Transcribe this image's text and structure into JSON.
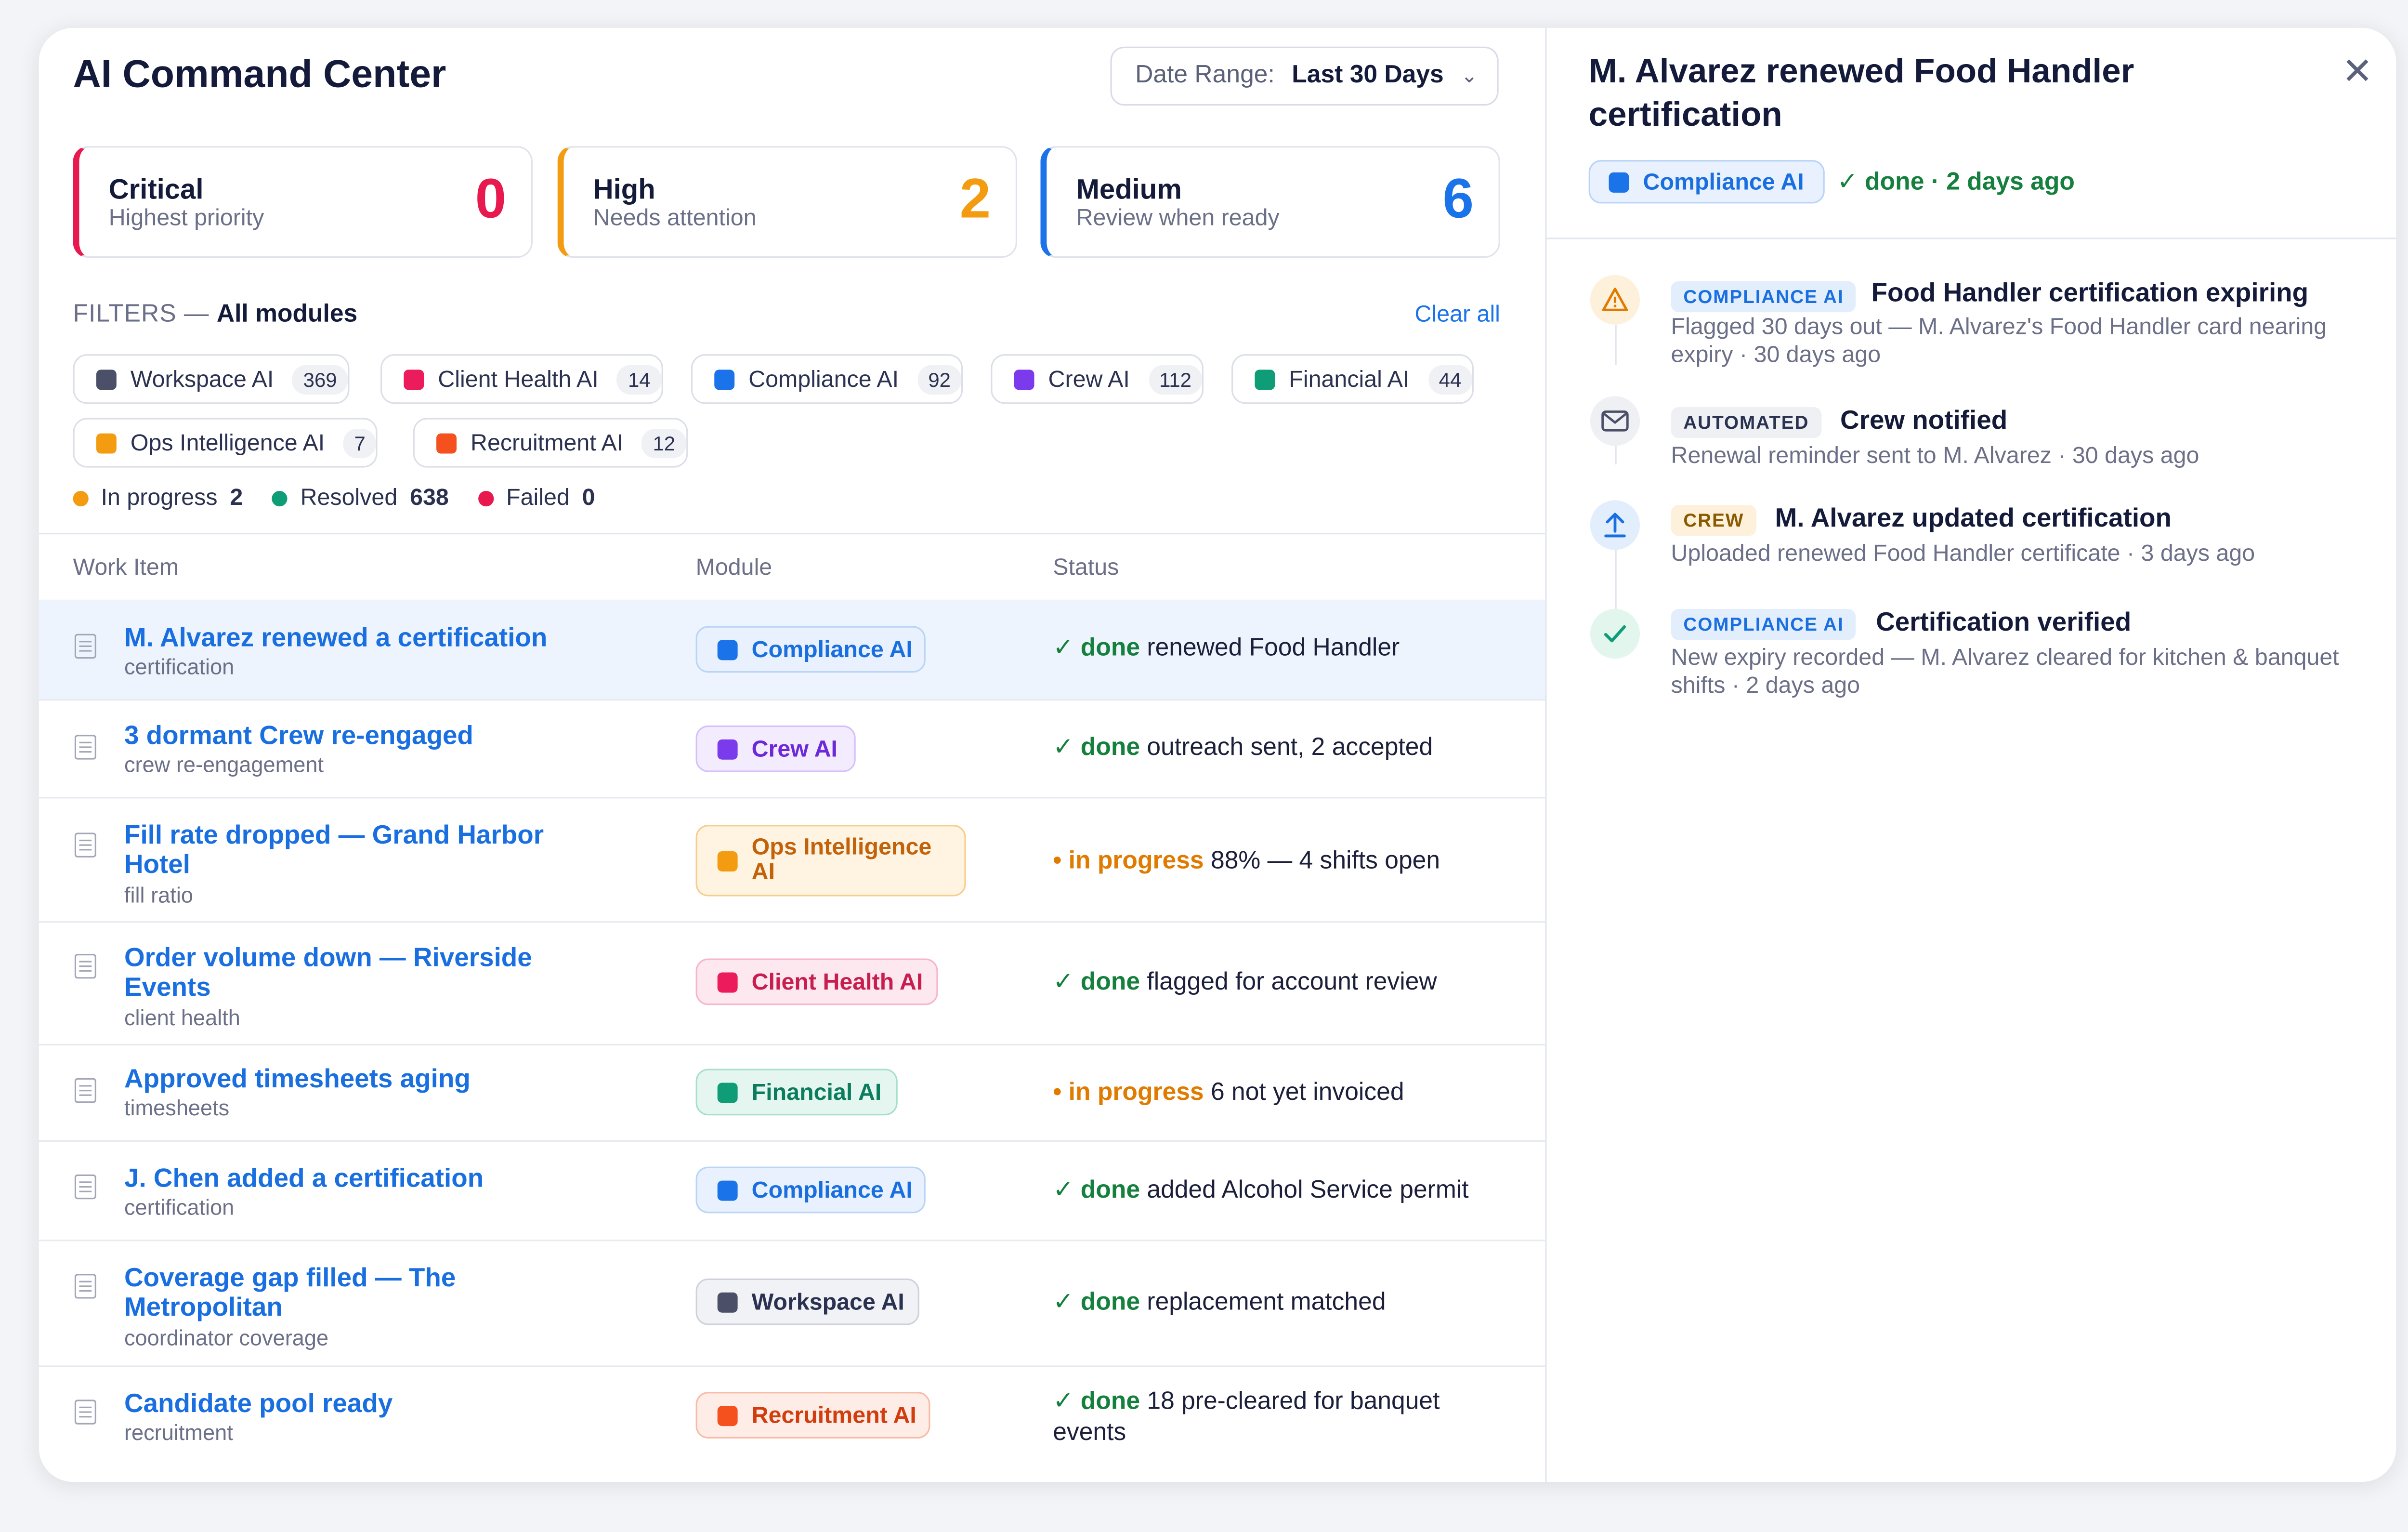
{
  "app_title": "AI Command Center",
  "date_range": {
    "label": "Date Range:",
    "value": "Last 30 Days"
  },
  "priority": [
    {
      "title": "Critical",
      "subtitle": "Highest priority",
      "count": "0",
      "color": "#e8194f"
    },
    {
      "title": "High",
      "subtitle": "Needs attention",
      "count": "2",
      "color": "#f39c12"
    },
    {
      "title": "Medium",
      "subtitle": "Review when ready",
      "count": "6",
      "color": "#1a73e8"
    }
  ],
  "filters": {
    "label": "FILTERS —",
    "scope": "All modules",
    "clear_all": "Clear all",
    "modules": [
      {
        "name": "Workspace AI",
        "count": "369",
        "color": "#4b5068"
      },
      {
        "name": "Client Health AI",
        "count": "14",
        "color": "#ec1b5b"
      },
      {
        "name": "Compliance AI",
        "count": "92",
        "color": "#1a73e8"
      },
      {
        "name": "Crew AI",
        "count": "112",
        "color": "#7c3aed"
      },
      {
        "name": "Financial AI",
        "count": "44",
        "color": "#0f9d77"
      },
      {
        "name": "Ops Intelligence AI",
        "count": "7",
        "color": "#f39c12"
      },
      {
        "name": "Recruitment AI",
        "count": "12",
        "color": "#f4511e"
      }
    ],
    "legend": [
      {
        "label": "In progress",
        "count": "2",
        "color": "#f39c12"
      },
      {
        "label": "Resolved",
        "count": "638",
        "color": "#0f9d77"
      },
      {
        "label": "Failed",
        "count": "0",
        "color": "#e8194f"
      }
    ]
  },
  "table": {
    "columns": [
      "Work Item",
      "Module",
      "Status"
    ],
    "rows": [
      {
        "title": "M. Alvarez renewed a certification",
        "sub": "certification",
        "module": "Compliance AI",
        "state": "done",
        "detail": "renewed Food Handler"
      },
      {
        "title": "3 dormant Crew re-engaged",
        "sub": "crew re-engagement",
        "module": "Crew AI",
        "state": "done",
        "detail": "outreach sent, 2 accepted"
      },
      {
        "title": "Fill rate dropped — Grand Harbor Hotel",
        "sub": "fill ratio",
        "module": "Ops Intelligence AI",
        "state": "in progress",
        "detail": "88% — 4 shifts open"
      },
      {
        "title": "Order volume down — Riverside Events",
        "sub": "client health",
        "module": "Client Health AI",
        "state": "done",
        "detail": "flagged for account review"
      },
      {
        "title": "Approved timesheets aging",
        "sub": "timesheets",
        "module": "Financial AI",
        "state": "in progress",
        "detail": "6 not yet invoiced"
      },
      {
        "title": "J. Chen added a certification",
        "sub": "certification",
        "module": "Compliance AI",
        "state": "done",
        "detail": "added Alcohol Service permit"
      },
      {
        "title": "Coverage gap filled — The Metropolitan",
        "sub": "coordinator coverage",
        "module": "Workspace AI",
        "state": "done",
        "detail": "replacement matched"
      },
      {
        "title": "Candidate pool ready",
        "sub": "recruitment",
        "module": "Recruitment AI",
        "state": "done",
        "detail": "18 pre-cleared for banquet events"
      }
    ]
  },
  "detail": {
    "title": "M. Alvarez renewed Food Handler certification",
    "module": "Compliance AI",
    "status": "✓ done · 2 days ago",
    "timeline": [
      {
        "tag": "COMPLIANCE AI",
        "headline": "Food Handler certification expiring",
        "body": "Flagged 30 days out — M. Alvarez's Food Handler card nearing expiry · 30 days ago",
        "icon": "warning-icon"
      },
      {
        "tag": "AUTOMATED",
        "headline": "Crew notified",
        "body": "Renewal reminder sent to M. Alvarez · 30 days ago",
        "icon": "mail-icon"
      },
      {
        "tag": "CREW",
        "headline": "M. Alvarez updated certification",
        "body": "Uploaded renewed Food Handler certificate · 3 days ago",
        "icon": "upload-icon"
      },
      {
        "tag": "COMPLIANCE AI",
        "headline": "Certification verified",
        "body": "New expiry recorded — M. Alvarez cleared for kitchen & banquet shifts · 2 days ago",
        "icon": "check-icon"
      }
    ]
  }
}
